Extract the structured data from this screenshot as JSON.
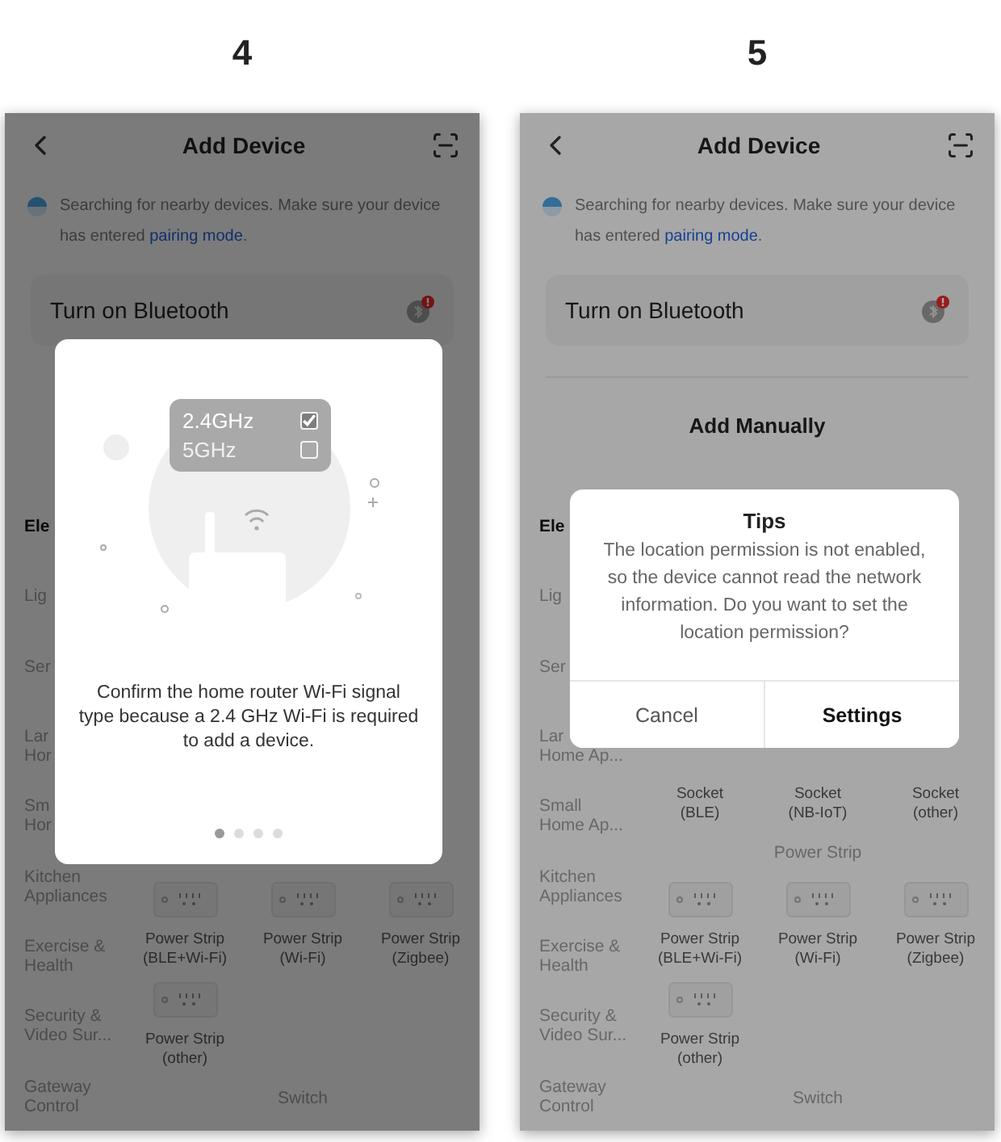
{
  "steps": [
    {
      "number": "4",
      "phone": {
        "title": "Add Device",
        "search": {
          "text": "Searching for nearby devices. Make sure your device has entered ",
          "link": "pairing mode",
          "end": "."
        },
        "bluetooth_card": {
          "label": "Turn on Bluetooth"
        },
        "categories": [
          {
            "label": "Ele",
            "selected": true
          },
          {
            "label": "Lig",
            "selected": false
          },
          {
            "label": "Ser",
            "selected": false
          },
          {
            "label": "Lar\nHor",
            "selected": false
          },
          {
            "label": "Sm\nHor",
            "selected": false
          },
          {
            "label": "Kitchen\nAppliances",
            "selected": false
          },
          {
            "label": "Exercise &\nHealth",
            "selected": false
          },
          {
            "label": "Security &\nVideo Sur...",
            "selected": false
          },
          {
            "label": "Gateway\nControl",
            "selected": false
          }
        ],
        "grid": [
          {
            "kind": "items",
            "items": [
              {
                "label": "Power Strip\n(BLE+Wi-Fi)",
                "icon": true
              },
              {
                "label": "Power Strip\n(Wi-Fi)",
                "icon": true
              },
              {
                "label": "Power Strip\n(Zigbee)",
                "icon": true
              }
            ]
          },
          {
            "kind": "items",
            "items": [
              {
                "label": "Power Strip\n(other)",
                "icon": true
              }
            ]
          },
          {
            "kind": "section",
            "title": "Switch"
          }
        ],
        "modal": {
          "kind": "carousel",
          "bands": [
            {
              "label": "2.4GHz",
              "checked": true
            },
            {
              "label": "5GHz",
              "checked": false
            }
          ],
          "message": "Confirm the home router Wi-Fi signal type because a 2.4 GHz Wi-Fi is required to add a device.",
          "pages": [
            {
              "selected": true
            },
            {
              "selected": false
            },
            {
              "selected": false
            },
            {
              "selected": false
            }
          ]
        }
      }
    },
    {
      "number": "5",
      "phone": {
        "title": "Add Device",
        "search": {
          "text": "Searching for nearby devices. Make sure your device has entered ",
          "link": "pairing mode",
          "end": "."
        },
        "bluetooth_card": {
          "label": "Turn on Bluetooth"
        },
        "manual_heading": "Add Manually",
        "categories": [
          {
            "label": "Ele",
            "selected": true
          },
          {
            "label": "Lig",
            "selected": false
          },
          {
            "label": "Ser",
            "selected": false
          },
          {
            "label": "Lar\nHome Ap...",
            "selected": false
          },
          {
            "label": "Small\nHome Ap...",
            "selected": false
          },
          {
            "label": "Kitchen\nAppliances",
            "selected": false
          },
          {
            "label": "Exercise &\nHealth",
            "selected": false
          },
          {
            "label": "Security &\nVideo Sur...",
            "selected": false
          },
          {
            "label": "Gateway\nControl",
            "selected": false
          }
        ],
        "grid": [
          {
            "kind": "items",
            "items": [
              {
                "label": "Socket\n(BLE)",
                "icon": false
              },
              {
                "label": "Socket\n(NB-IoT)",
                "icon": false
              },
              {
                "label": "Socket\n(other)",
                "icon": false
              }
            ]
          },
          {
            "kind": "section",
            "title": "Power Strip"
          },
          {
            "kind": "items",
            "items": [
              {
                "label": "Power Strip\n(BLE+Wi-Fi)",
                "icon": true
              },
              {
                "label": "Power Strip\n(Wi-Fi)",
                "icon": true
              },
              {
                "label": "Power Strip\n(Zigbee)",
                "icon": true
              }
            ]
          },
          {
            "kind": "items",
            "items": [
              {
                "label": "Power Strip\n(other)",
                "icon": true
              }
            ]
          },
          {
            "kind": "section",
            "title": "Switch"
          }
        ],
        "modal": {
          "kind": "dialog",
          "title": "Tips",
          "message": "The location permission is not enabled, so the device cannot read the network information. Do you want to set the location permission?",
          "buttons": [
            {
              "label": "Cancel",
              "primary": false
            },
            {
              "label": "Settings",
              "primary": true
            }
          ]
        }
      }
    }
  ]
}
